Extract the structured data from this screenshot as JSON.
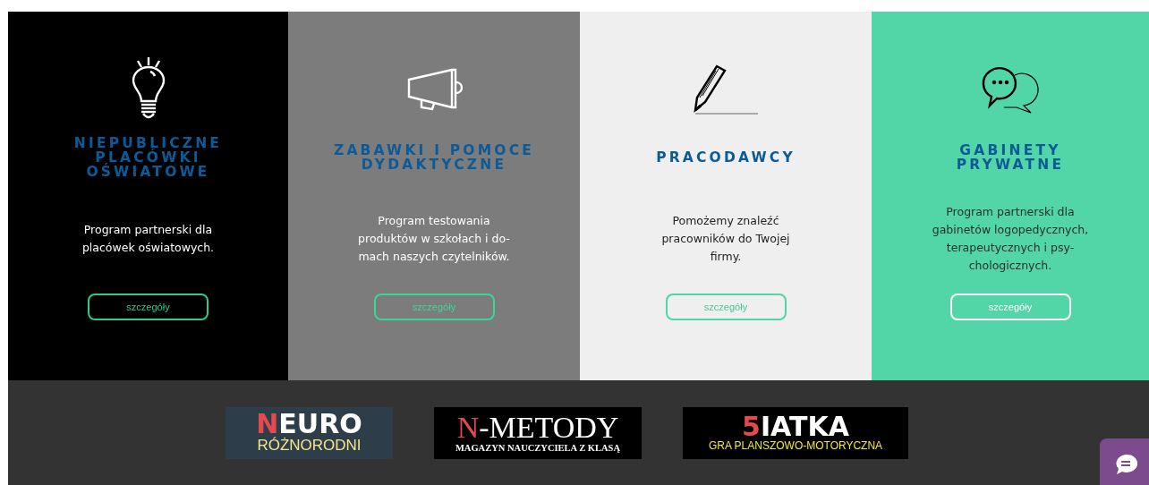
{
  "cards": [
    {
      "kind": "dark",
      "title": "NIEPUBLICZNE\nPLACÓWKI\nOŚWIATOWE",
      "description": "Program partnerski dla\nplacówek oświatowych.",
      "button": "szczegóły"
    },
    {
      "kind": "grey",
      "title": "ZABAWKI I POMOCE\nDYDAKTYCZNE",
      "description": "Program testowania\nproduktów w szkołach i do-\nmach naszych czytelników.",
      "button": "szczegóły"
    },
    {
      "kind": "light",
      "title": "PRACODAWCY",
      "description": "Pomożemy znaleźć\npracowników do Twojej\nfirmy.",
      "button": "szczegóły"
    },
    {
      "kind": "green",
      "title": "GABINETY\nPRYWATNE",
      "description": "Program partnerski dla\ngabinetów logopedycznych,\nterapeutycznych i psy-\nchologicznych.",
      "button": "szczegóły"
    }
  ],
  "logos": [
    {
      "kind": "neuro",
      "initial": "N",
      "rest": "EURO",
      "tagline": "RÓŻNORODNI"
    },
    {
      "kind": "metody",
      "initial": "N",
      "rest": "-METODY",
      "tagline": "MAGAZYN NAUCZYCIELA Z KLASĄ"
    },
    {
      "kind": "siatka",
      "initial": "5",
      "rest": "IATKA",
      "tagline": "GRA PLANSZOWO-MOTORYCZNA"
    }
  ]
}
